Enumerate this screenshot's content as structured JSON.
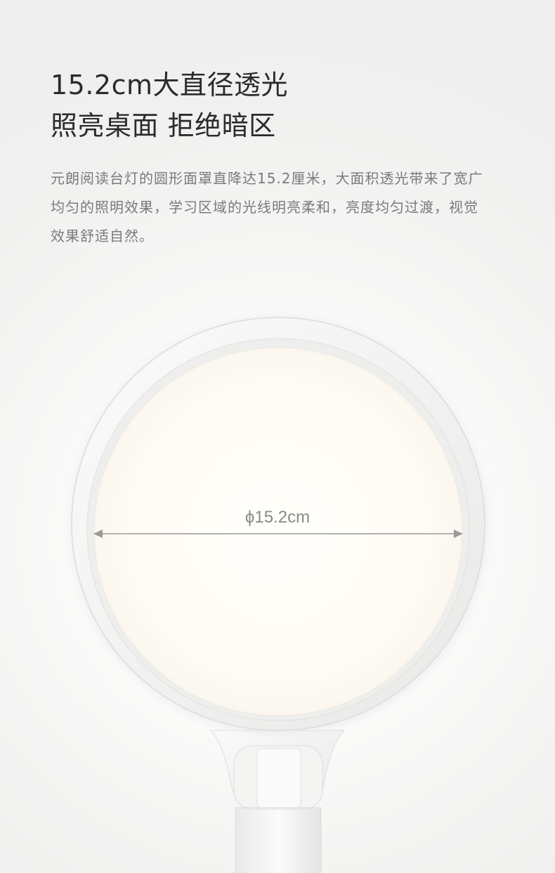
{
  "headline": {
    "line1": "15.2cm大直径透光",
    "line2": "照亮桌面 拒绝暗区"
  },
  "description": "元朗阅读台灯的圆形面罩直降达15.2厘米，大面积透光带来了宽广均匀的照明效果，学习区域的光线明亮柔和，亮度均匀过渡，视觉效果舒适自然。",
  "lamp": {
    "diameter_label": "ϕ15.2cm"
  },
  "colors": {
    "background": "#f3f3f3",
    "headline": "#2b2b2b",
    "body_text": "#7a7a7a",
    "lamp_frame": "#f1f1f0",
    "light_panel": "#fffdf8",
    "measure_line": "#9a9a9a"
  }
}
